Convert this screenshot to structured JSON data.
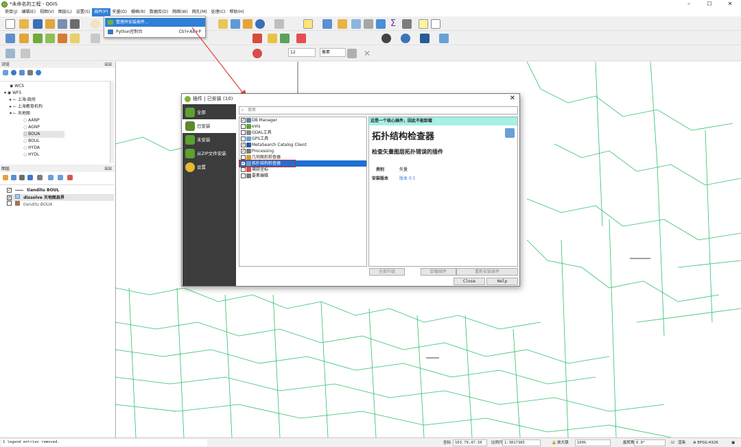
{
  "window": {
    "title": "*未命名的工程 - QGIS",
    "min": "–",
    "max": "☐",
    "close": "✕"
  },
  "menu": [
    "项目(J)",
    "编辑(E)",
    "视图(V)",
    "图层(L)",
    "设置(S)",
    "插件(P)",
    "矢量(O)",
    "栅格(R)",
    "数据库(D)",
    "网络(W)",
    "网孔(M)",
    "处理(C)",
    "帮助(H)"
  ],
  "plugin_menu": {
    "items": [
      {
        "label": "管理并安装插件...",
        "shortcut": ""
      },
      {
        "label": "Python控制台",
        "shortcut": "Ctrl+Alt+P"
      }
    ]
  },
  "toolbar": {
    "scale_field": "12",
    "units_select": "像素"
  },
  "browser": {
    "title": "浏览",
    "close": "☒☒",
    "items": [
      {
        "label": "WCS",
        "indent": 1
      },
      {
        "label": "WFS",
        "indent": 1
      },
      {
        "label": "上海-政府",
        "indent": 2
      },
      {
        "label": "上海教育机构",
        "indent": 2
      },
      {
        "label": "天地图",
        "indent": 2
      },
      {
        "label": "AANP",
        "indent": 3
      },
      {
        "label": "AGNP",
        "indent": 3
      },
      {
        "label": "BOUA",
        "indent": 3
      },
      {
        "label": "BOUL",
        "indent": 3
      },
      {
        "label": "HYDA",
        "indent": 3
      },
      {
        "label": "HYDL",
        "indent": 3
      }
    ]
  },
  "layers": {
    "title": "图层",
    "close": "☒☒",
    "items": [
      {
        "label": "tianditu BOUL",
        "checked": true,
        "style": "bold"
      },
      {
        "label": "dissolve 天地图县界",
        "checked": true,
        "style": "bold"
      },
      {
        "label": "tianditu BOUA",
        "checked": false,
        "style": "italic"
      }
    ]
  },
  "dialog": {
    "title": "插件 | 已安装 (10)",
    "close": "✕",
    "sidebar": [
      "全部",
      "已安装",
      "未安装",
      "从ZIP文件安装",
      "设置"
    ],
    "search_placeholder": "搜索",
    "plugins": [
      {
        "name": "DB Manager",
        "checked": true
      },
      {
        "name": "eVis",
        "checked": false
      },
      {
        "name": "GDAL工具",
        "checked": false
      },
      {
        "name": "GPS工具",
        "checked": false
      },
      {
        "name": "MetaSearch Catalog Client",
        "checked": true
      },
      {
        "name": "Processing",
        "checked": true
      },
      {
        "name": "几何图形检查器",
        "checked": false
      },
      {
        "name": "拓扑结构检查器",
        "checked": true
      },
      {
        "name": "捕获坐标",
        "checked": false
      },
      {
        "name": "要素编辑",
        "checked": false
      }
    ],
    "detail": {
      "banner": "这是一个核心插件，因此不能卸载",
      "name": "拓扑结构检查器",
      "desc": "检查矢量图层拓扑错误的插件",
      "category_label": "类别",
      "category": "矢量",
      "version_label": "安装版本",
      "version": "版本 0.1"
    },
    "buttons": {
      "upgrade_all": "全部升级",
      "uninstall": "卸载插件",
      "reinstall": "重新安装插件",
      "close": "Close",
      "help": "Help"
    }
  },
  "status": {
    "log": "1 legend entries removed.",
    "coord_label": "坐标",
    "coord": "103.79,47.56",
    "scale_label": "比例尺",
    "scale": "1:3817385",
    "mag_label": "放大镜",
    "mag": "100%",
    "rot_label": "旋转角度",
    "rot": "0.0°",
    "render_label": "渲染",
    "crs": "EPSG:4326"
  },
  "colors": {
    "accent": "#2f7fd6",
    "map_lines": "#2fbf6a",
    "dialog_side": "#3c3c3c",
    "banner": "#a6f0e6",
    "arrow": "#e0403a"
  }
}
